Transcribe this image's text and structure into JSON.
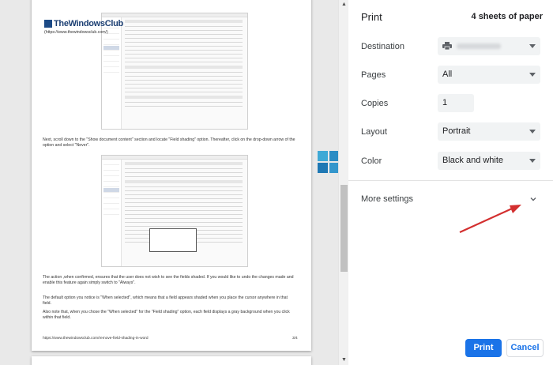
{
  "preview": {
    "watermark_brand": "TheWindowsClub",
    "watermark_url": "(https://www.thewindowsclub.com/)",
    "para1": "Next, scroll down to the \"Show document content\" section and locate \"Field shading\" option. Thereafter, click on the drop-down arrow of the option and select \"Never\".",
    "para2": "The action ,when confirmed, ensures that the user does not wish to see the fields shaded. If you would like to undo the changes made and enable this feature again simply switch to \"Always\".",
    "para3": "The default option you notice is \"When selected\", which means that a field appears shaded when you place the cursor anywhere in that field.",
    "para4": "Also note that, when you chose the \"When selected\" for the \"Field shading\" option, each field displays a gray background when you click within that field.",
    "footer_url": "https://www.thewindowsclub.com/remove-field-shading-in-word",
    "footer_page": "3/4",
    "ms_logo_colors": [
      "#f25022",
      "#7fba00",
      "#00a4ef",
      "#ffb900"
    ]
  },
  "panel": {
    "title": "Print",
    "sheets": "4 sheets of paper",
    "destination_label": "Destination",
    "pages_label": "Pages",
    "pages_value": "All",
    "copies_label": "Copies",
    "copies_value": "1",
    "layout_label": "Layout",
    "layout_value": "Portrait",
    "color_label": "Color",
    "color_value": "Black and white",
    "more_settings_label": "More settings",
    "print_button": "Print",
    "cancel_button": "Cancel",
    "accent_color": "#1a73e8",
    "annotation_arrow_color": "#d32f2f"
  }
}
